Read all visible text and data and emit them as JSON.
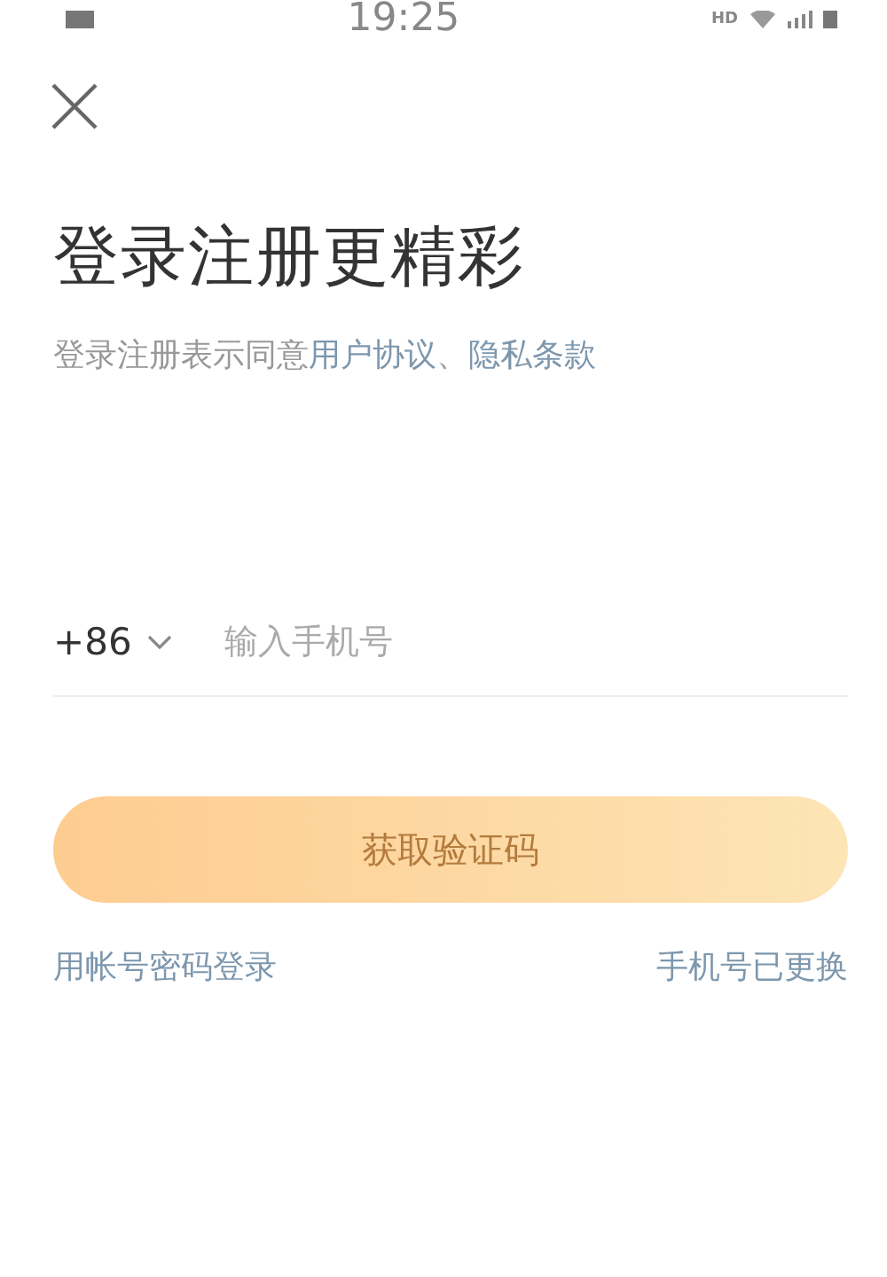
{
  "status_bar": {
    "time": "19:25",
    "network": "HD"
  },
  "title": "登录注册更精彩",
  "agreement": [
    {
      "kind": "text",
      "text": "登录注册表示同意"
    },
    {
      "kind": "link",
      "text": "用户协议"
    },
    {
      "kind": "text",
      "text": "、"
    },
    {
      "kind": "link",
      "text": "隐私条款"
    }
  ],
  "phone": {
    "country_code": "+86",
    "placeholder": "输入手机号"
  },
  "submit": {
    "label": "获取验证码",
    "disabled": true
  },
  "links": [
    "用帐号密码登录",
    "手机号已更换"
  ]
}
